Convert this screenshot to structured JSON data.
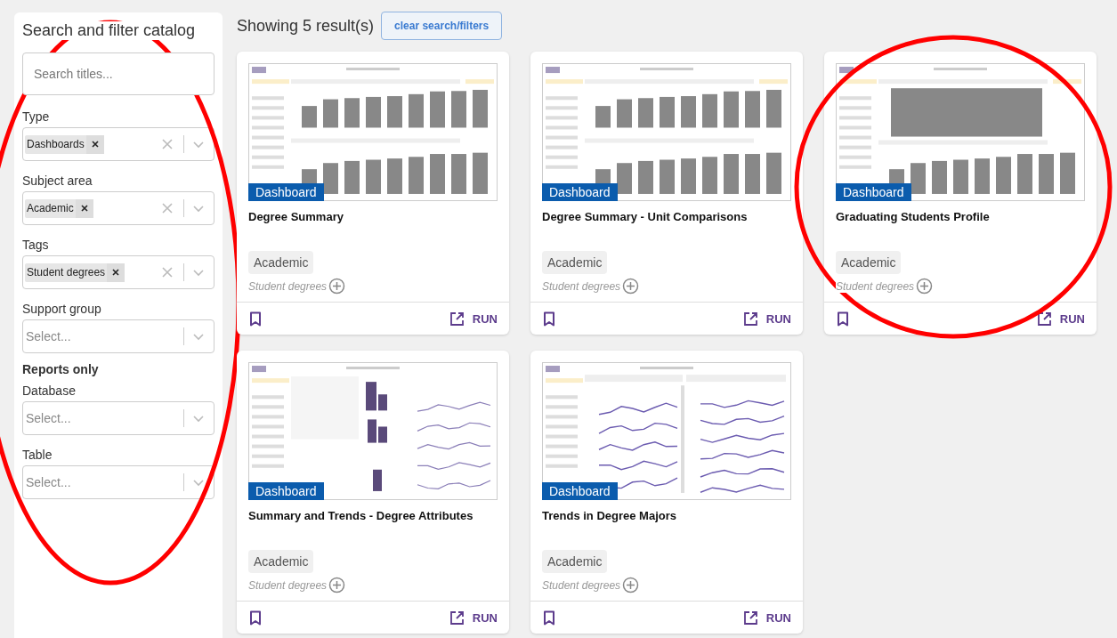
{
  "sidebar": {
    "title": "Search and filter catalog",
    "circled": true,
    "search": {
      "placeholder": "Search titles..."
    },
    "filters": [
      {
        "kind": "select",
        "label": "Type",
        "chips": [
          "Dashboards"
        ]
      },
      {
        "kind": "select",
        "label": "Subject area",
        "chips": [
          "Academic"
        ]
      },
      {
        "kind": "select",
        "label": "Tags",
        "chips": [
          "Student degrees"
        ]
      },
      {
        "kind": "select",
        "label": "Support group",
        "placeholder": "Select..."
      },
      {
        "kind": "heading",
        "label": "Reports only"
      },
      {
        "kind": "select",
        "label": "Database",
        "placeholder": "Select..."
      },
      {
        "kind": "select",
        "label": "Table",
        "placeholder": "Select..."
      }
    ]
  },
  "results": {
    "count_text": "Showing 5 result(s)",
    "clear_button": "clear search/filters"
  },
  "cards": [
    {
      "kind": "bars",
      "badge": "Dashboard",
      "title": "Degree Summary",
      "subject": "Academic",
      "tag": "Student degrees",
      "run": "RUN",
      "circled": false
    },
    {
      "kind": "bars",
      "badge": "Dashboard",
      "title": "Degree Summary - Unit Comparisons",
      "subject": "Academic",
      "tag": "Student degrees",
      "run": "RUN",
      "circled": false
    },
    {
      "kind": "big-bar",
      "badge": "Dashboard",
      "title": "Graduating Students Profile",
      "subject": "Academic",
      "tag": "Student degrees",
      "run": "RUN",
      "circled": true
    },
    {
      "kind": "mixed",
      "badge": "Dashboard",
      "title": "Summary and Trends - Degree Attributes",
      "subject": "Academic",
      "tag": "Student degrees",
      "run": "RUN",
      "circled": false
    },
    {
      "kind": "lines",
      "badge": "Dashboard",
      "title": "Trends in Degree Majors",
      "subject": "Academic",
      "tag": "Student degrees",
      "run": "RUN",
      "circled": false
    }
  ]
}
